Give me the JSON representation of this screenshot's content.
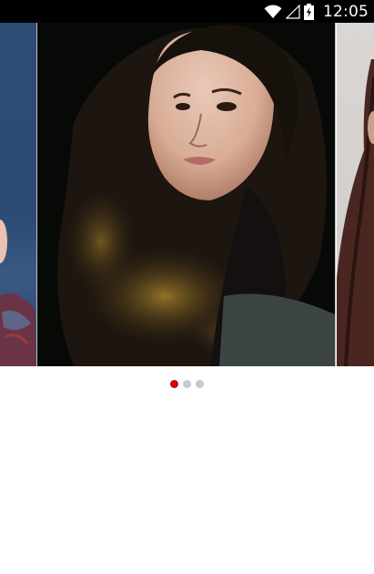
{
  "status_bar": {
    "time": "12:05",
    "icons": [
      "wifi-icon",
      "signal-icon",
      "battery-charging-icon"
    ]
  },
  "carousel": {
    "slides": [
      {
        "name": "portrait-slide-left",
        "description_hidden": true
      },
      {
        "name": "portrait-slide-center",
        "description_hidden": true
      },
      {
        "name": "portrait-slide-right",
        "description_hidden": true
      }
    ],
    "page_count": 3,
    "active_index": 0,
    "colors": {
      "active_dot": "#d50000",
      "inactive_dot": "#c8c8c8"
    }
  }
}
